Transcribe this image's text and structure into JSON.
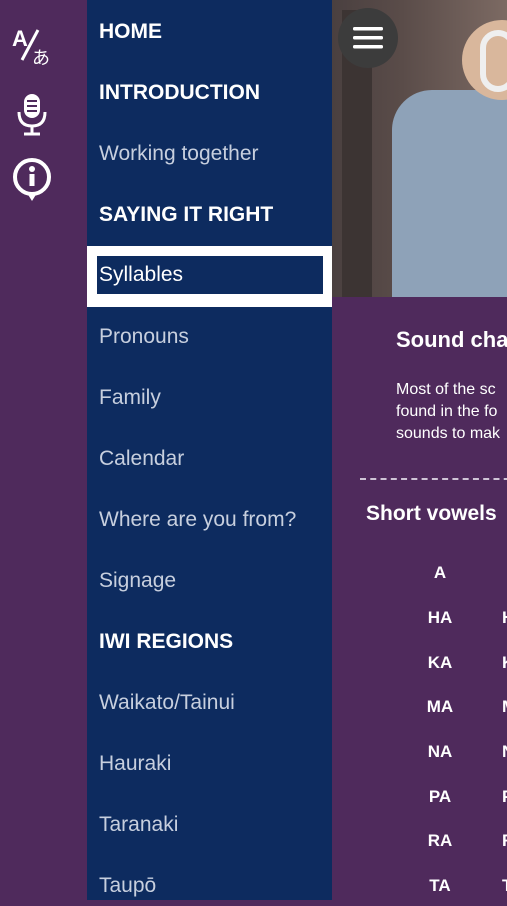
{
  "rail": {
    "icons": [
      "translate-icon",
      "microphone-icon",
      "info-icon"
    ]
  },
  "nav": {
    "items": [
      {
        "label": "HOME",
        "heading": true
      },
      {
        "label": "INTRODUCTION",
        "heading": true
      },
      {
        "label": "Working together",
        "heading": false
      },
      {
        "label": "SAYING IT RIGHT",
        "heading": true
      },
      {
        "label": "Syllables",
        "heading": false,
        "selected": true
      },
      {
        "label": "Pronouns",
        "heading": false
      },
      {
        "label": "Family",
        "heading": false
      },
      {
        "label": "Calendar",
        "heading": false
      },
      {
        "label": "Where are you from?",
        "heading": false
      },
      {
        "label": "Signage",
        "heading": false
      },
      {
        "label": "IWI REGIONS",
        "heading": true
      },
      {
        "label": "Waikato/Tainui",
        "heading": false
      },
      {
        "label": "Hauraki",
        "heading": false
      },
      {
        "label": "Taranaki",
        "heading": false
      },
      {
        "label": "Taupō",
        "heading": false
      }
    ]
  },
  "content": {
    "title": "Sound char",
    "body_lines": [
      "Most of the sc",
      "found in the fo",
      "sounds to mak"
    ],
    "short_vowels_title": "Short vowels",
    "vowels": [
      "A",
      "HA",
      "KA",
      "MA",
      "NA",
      "PA",
      "RA",
      "TA"
    ],
    "vowels_col2": [
      "",
      "H",
      "K",
      "M",
      "N",
      "P",
      "R",
      "T"
    ]
  },
  "colors": {
    "rail": "#4f2a5c",
    "nav": "#0d2b5f",
    "content": "#4f2a5c",
    "selected_outline": "#ffffff"
  }
}
